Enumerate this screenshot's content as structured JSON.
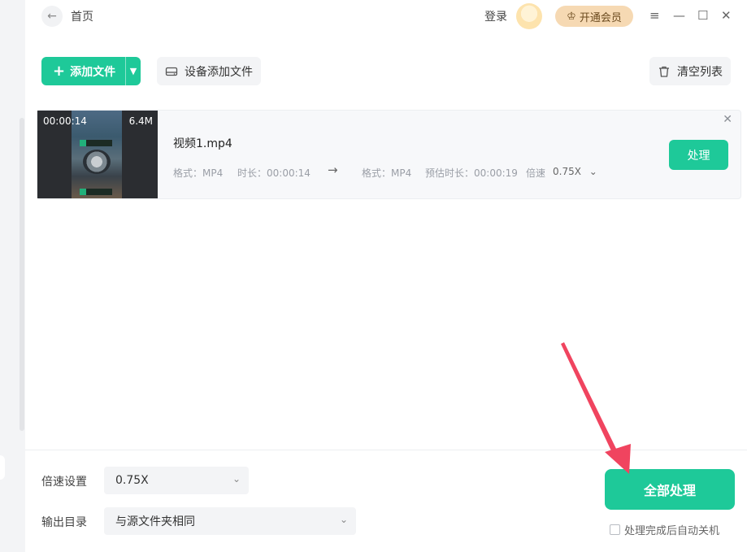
{
  "header": {
    "title": "首页",
    "login_label": "登录",
    "vip_label": "开通会员",
    "window_controls": [
      "≡",
      "—",
      "☐",
      "✕"
    ]
  },
  "toolbar": {
    "add_file_label": "添加文件",
    "device_add_label": "设备添加文件",
    "clear_list_label": "清空列表"
  },
  "file_list": [
    {
      "thumbnail_duration": "00:00:14",
      "thumbnail_size": "6.4M",
      "name": "视频1.mp4",
      "src_format": "格式：MP4",
      "src_duration": "时长：00:00:14",
      "arrow": "→",
      "dst_format": "格式：MP4",
      "est_duration": "预估时长：00:00:19",
      "speed_label": "倍速",
      "speed_value": "0.75X",
      "process_label": "处理"
    }
  ],
  "footer": {
    "speed_setting_label": "倍速设置",
    "speed_setting_value": "0.75X",
    "output_dir_label": "输出目录",
    "output_dir_value": "与源文件夹相同",
    "process_all_label": "全部处理",
    "auto_shutdown_label": "处理完成后自动关机"
  },
  "colors": {
    "accent": "#1ec999",
    "vip_bg": "#f6d9b3",
    "annotation_arrow": "#f0445f"
  }
}
